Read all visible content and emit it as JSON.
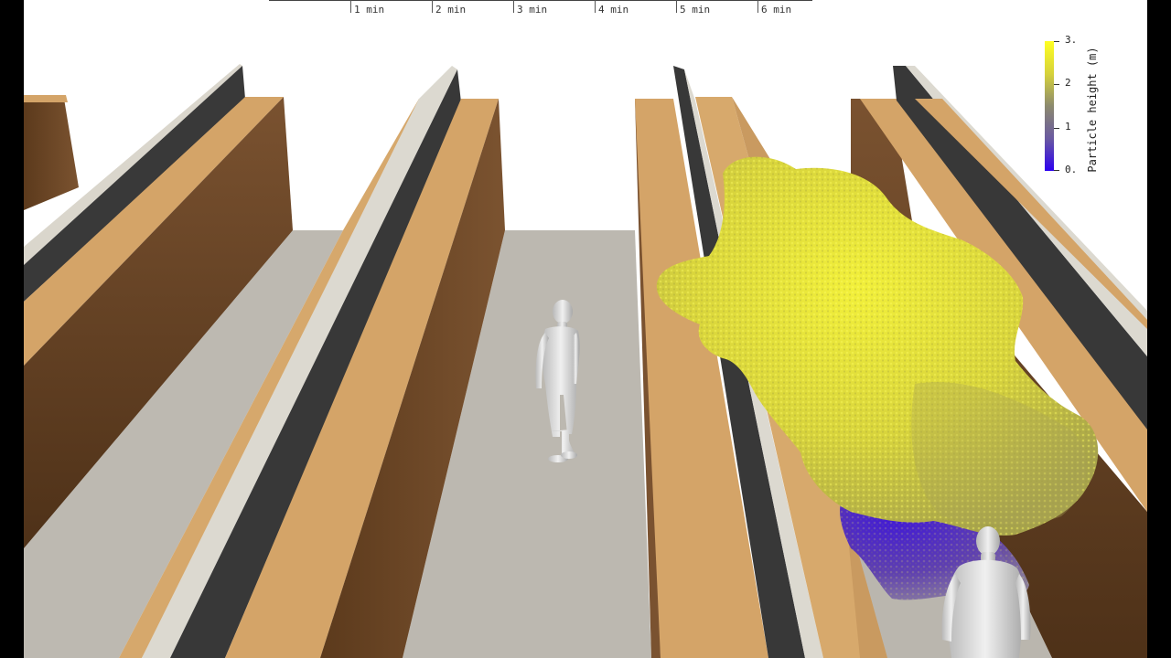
{
  "timeline": {
    "ticks": [
      "1 min",
      "2 min",
      "3 min",
      "4 min",
      "5 min",
      "6 min"
    ]
  },
  "colorbar": {
    "title": "Particle height (m)",
    "labels": [
      "3.",
      "2",
      "1",
      "0."
    ],
    "colors": [
      "#ffff22",
      "#d6d23a",
      "#8c8a6e",
      "#6a5aa0",
      "#2d00f0"
    ]
  },
  "scene_colors": {
    "sky": "#ffffff",
    "floor": "#bcb8b0",
    "shelf_top": "#d4a468",
    "shelf_side": "#6a4524",
    "divider_dark": "#383838",
    "divider_light": "#dcd9d0",
    "particles_high": "#e4e430",
    "particles_low": "#3a10d0",
    "mannequin": "#d8d8d8"
  }
}
